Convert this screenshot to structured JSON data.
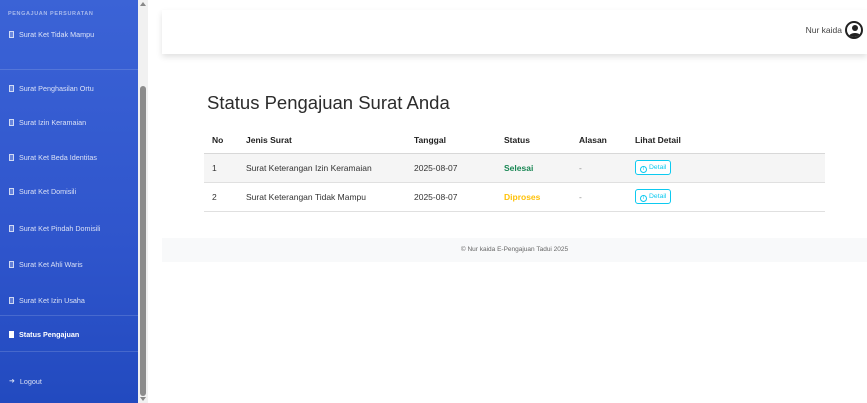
{
  "sidebar": {
    "heading": "PENGAJUAN PERSURATAN",
    "items": [
      {
        "label": "Surat Ket Tidak Mampu"
      },
      {
        "label": "Surat Penghasilan Ortu"
      },
      {
        "label": "Surat Izin Keramaian"
      },
      {
        "label": "Surat Ket Beda Identitas"
      },
      {
        "label": "Surat Ket Domisili"
      },
      {
        "label": "Surat Ket Pindah Domisili"
      },
      {
        "label": "Surat Ket Ahli Waris"
      },
      {
        "label": "Surat Ket Izin Usaha"
      },
      {
        "label": "Status Pengajuan"
      }
    ],
    "logout_label": "Logout"
  },
  "topbar": {
    "user_name": "Nur kaida"
  },
  "main": {
    "title": "Status Pengajuan Surat Anda",
    "table": {
      "headers": [
        "No",
        "Jenis Surat",
        "Tanggal",
        "Status",
        "Alasan",
        "Lihat Detail"
      ],
      "rows": [
        {
          "no": "1",
          "jenis": "Surat Keterangan Izin Keramaian",
          "tanggal": "2025-08-07",
          "status": "Selesai",
          "alasan": "-",
          "detail": "Detail"
        },
        {
          "no": "2",
          "jenis": "Surat Keterangan Tidak Mampu",
          "tanggal": "2025-08-07",
          "status": "Diproses",
          "alasan": "-",
          "detail": "Detail"
        }
      ]
    }
  },
  "footer": {
    "text": "© Nur kaida E-Pengajuan Tadui 2025"
  },
  "colors": {
    "sidebar": "#2f55cc",
    "selesai": "#198754",
    "diproses": "#ffc107",
    "detail": "#0dcaf0"
  }
}
